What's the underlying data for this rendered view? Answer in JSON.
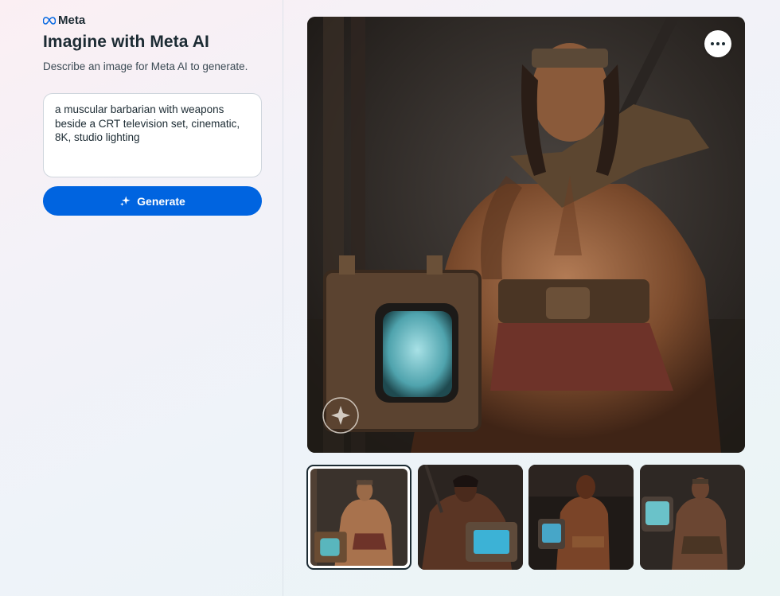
{
  "brand": {
    "name": "Meta",
    "logo_icon": "meta-infinity-icon"
  },
  "page": {
    "title": "Imagine with Meta AI",
    "subtitle": "Describe an image for Meta AI to generate."
  },
  "prompt": {
    "value": "a muscular barbarian with weapons beside a CRT television set, cinematic, 8K, studio lighting"
  },
  "generate_button": {
    "label": "Generate",
    "icon": "sparkle-icon"
  },
  "main_image": {
    "alt": "a muscular barbarian with weapons beside a CRT television set",
    "menu_icon": "more-horizontal-icon",
    "watermark_icon": "imagined-with-ai-watermark-icon"
  },
  "thumbnails": [
    {
      "selected": true
    },
    {
      "selected": false
    },
    {
      "selected": false
    },
    {
      "selected": false
    }
  ],
  "colors": {
    "accent": "#0064e0",
    "text": "#1c2b33"
  }
}
